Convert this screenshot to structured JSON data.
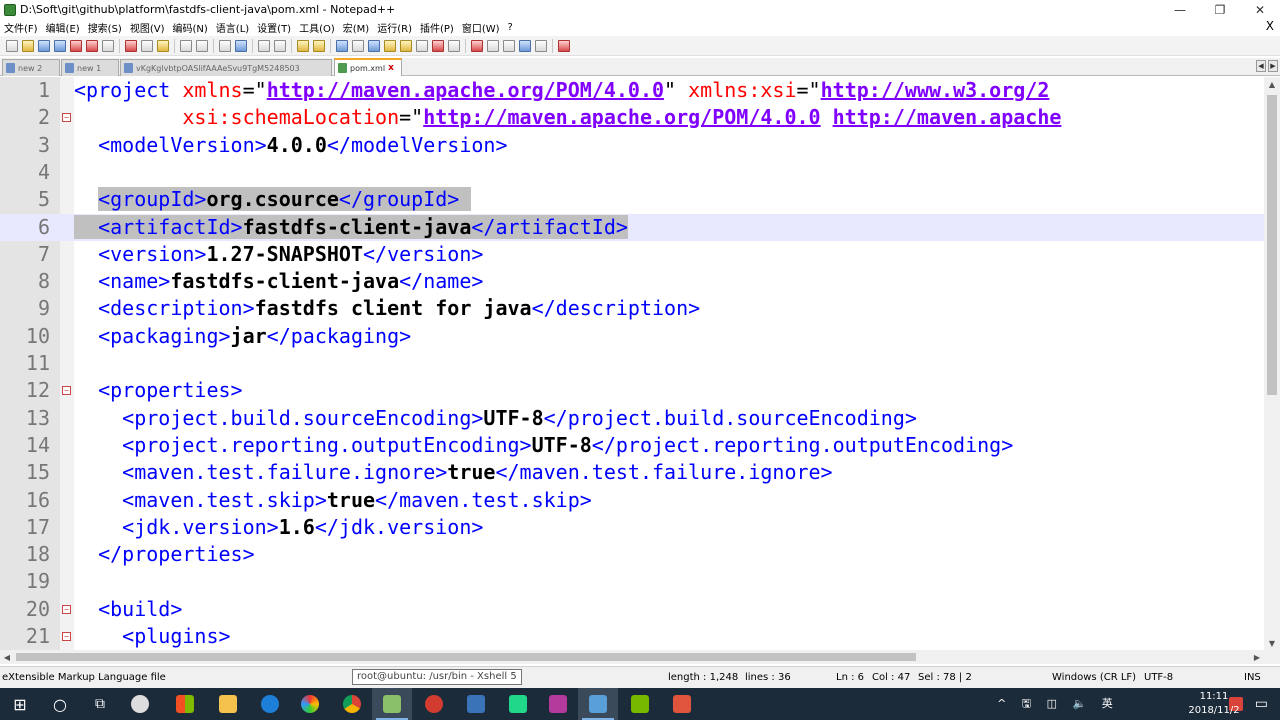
{
  "window": {
    "title": "D:\\Soft\\git\\github\\platform\\fastdfs-client-java\\pom.xml - Notepad++",
    "minimize": "—",
    "maximize": "❐",
    "close": "✕"
  },
  "menu": [
    "文件(F)",
    "编辑(E)",
    "搜索(S)",
    "视图(V)",
    "编码(N)",
    "语言(L)",
    "设置(T)",
    "工具(O)",
    "宏(M)",
    "运行(R)",
    "插件(P)",
    "窗口(W)",
    "?"
  ],
  "menu_close": "X",
  "tabs": [
    {
      "label": "new 2",
      "active": false
    },
    {
      "label": "new 1",
      "active": false
    },
    {
      "label": "vKgKglvbtpOASlifAAAeSvu9TgM5248503",
      "active": false
    },
    {
      "label": "pom.xml",
      "active": true
    }
  ],
  "tab_close": "x",
  "editor": {
    "lines": [
      {
        "n": "1",
        "fold": false,
        "parts": [
          {
            "t": "<project ",
            "c": "tag"
          },
          {
            "t": "xmlns",
            "c": "attr"
          },
          {
            "t": "=\"",
            "c": "eq"
          },
          {
            "t": "http://maven.apache.org/POM/4.0.0",
            "c": "val"
          },
          {
            "t": "\" ",
            "c": "eq"
          },
          {
            "t": "xmlns:xsi",
            "c": "attr"
          },
          {
            "t": "=\"",
            "c": "eq"
          },
          {
            "t": "http://www.w3.org/2",
            "c": "val"
          }
        ]
      },
      {
        "n": "2",
        "fold": true,
        "parts": [
          {
            "t": "         ",
            "c": "eq"
          },
          {
            "t": "xsi:schemaLocation",
            "c": "attr"
          },
          {
            "t": "=\"",
            "c": "eq"
          },
          {
            "t": "http://maven.apache.org/POM/4.0.0",
            "c": "val"
          },
          {
            "t": " ",
            "c": "eq"
          },
          {
            "t": "http://maven.apache",
            "c": "val"
          }
        ]
      },
      {
        "n": "3",
        "fold": false,
        "parts": [
          {
            "t": "  ",
            "c": "eq"
          },
          {
            "t": "<modelVersion>",
            "c": "tag"
          },
          {
            "t": "4.0.0",
            "c": "txt"
          },
          {
            "t": "</modelVersion>",
            "c": "tag"
          }
        ]
      },
      {
        "n": "4",
        "fold": false,
        "parts": []
      },
      {
        "n": "5",
        "fold": false,
        "parts": [
          {
            "t": "  ",
            "c": "eq"
          },
          {
            "t": "<groupId>",
            "c": "tag sel"
          },
          {
            "t": "org.csource",
            "c": "txt sel"
          },
          {
            "t": "</groupId>",
            "c": "tag sel"
          },
          {
            "t": " ",
            "c": "eq sel"
          }
        ]
      },
      {
        "n": "6",
        "fold": false,
        "current": true,
        "parts": [
          {
            "t": "  ",
            "c": "eq sel"
          },
          {
            "t": "<artifactId>",
            "c": "tag sel"
          },
          {
            "t": "fastdfs-client-java",
            "c": "txt sel"
          },
          {
            "t": "</artifactId>",
            "c": "tag sel"
          }
        ]
      },
      {
        "n": "7",
        "fold": false,
        "parts": [
          {
            "t": "  ",
            "c": "eq"
          },
          {
            "t": "<version>",
            "c": "tag"
          },
          {
            "t": "1.27-SNAPSHOT",
            "c": "txt"
          },
          {
            "t": "</version>",
            "c": "tag"
          }
        ]
      },
      {
        "n": "8",
        "fold": false,
        "parts": [
          {
            "t": "  ",
            "c": "eq"
          },
          {
            "t": "<name>",
            "c": "tag"
          },
          {
            "t": "fastdfs-client-java",
            "c": "txt"
          },
          {
            "t": "</name>",
            "c": "tag"
          }
        ]
      },
      {
        "n": "9",
        "fold": false,
        "parts": [
          {
            "t": "  ",
            "c": "eq"
          },
          {
            "t": "<description>",
            "c": "tag"
          },
          {
            "t": "fastdfs client for java",
            "c": "txt"
          },
          {
            "t": "</description>",
            "c": "tag"
          }
        ]
      },
      {
        "n": "10",
        "fold": false,
        "parts": [
          {
            "t": "  ",
            "c": "eq"
          },
          {
            "t": "<packaging>",
            "c": "tag"
          },
          {
            "t": "jar",
            "c": "txt"
          },
          {
            "t": "</packaging>",
            "c": "tag"
          }
        ]
      },
      {
        "n": "11",
        "fold": false,
        "parts": []
      },
      {
        "n": "12",
        "fold": true,
        "parts": [
          {
            "t": "  ",
            "c": "eq"
          },
          {
            "t": "<properties>",
            "c": "tag"
          }
        ]
      },
      {
        "n": "13",
        "fold": false,
        "parts": [
          {
            "t": "    ",
            "c": "eq"
          },
          {
            "t": "<project.build.sourceEncoding>",
            "c": "tag"
          },
          {
            "t": "UTF-8",
            "c": "txt"
          },
          {
            "t": "</project.build.sourceEncoding>",
            "c": "tag"
          }
        ]
      },
      {
        "n": "14",
        "fold": false,
        "parts": [
          {
            "t": "    ",
            "c": "eq"
          },
          {
            "t": "<project.reporting.outputEncoding>",
            "c": "tag"
          },
          {
            "t": "UTF-8",
            "c": "txt"
          },
          {
            "t": "</project.reporting.outputEncoding>",
            "c": "tag"
          }
        ]
      },
      {
        "n": "15",
        "fold": false,
        "parts": [
          {
            "t": "    ",
            "c": "eq"
          },
          {
            "t": "<maven.test.failure.ignore>",
            "c": "tag"
          },
          {
            "t": "true",
            "c": "txt"
          },
          {
            "t": "</maven.test.failure.ignore>",
            "c": "tag"
          }
        ]
      },
      {
        "n": "16",
        "fold": false,
        "parts": [
          {
            "t": "    ",
            "c": "eq"
          },
          {
            "t": "<maven.test.skip>",
            "c": "tag"
          },
          {
            "t": "true",
            "c": "txt"
          },
          {
            "t": "</maven.test.skip>",
            "c": "tag"
          }
        ]
      },
      {
        "n": "17",
        "fold": false,
        "parts": [
          {
            "t": "    ",
            "c": "eq"
          },
          {
            "t": "<jdk.version>",
            "c": "tag"
          },
          {
            "t": "1.6",
            "c": "txt"
          },
          {
            "t": "</jdk.version>",
            "c": "tag"
          }
        ]
      },
      {
        "n": "18",
        "fold": false,
        "parts": [
          {
            "t": "  ",
            "c": "eq"
          },
          {
            "t": "</properties>",
            "c": "tag"
          }
        ]
      },
      {
        "n": "19",
        "fold": false,
        "parts": []
      },
      {
        "n": "20",
        "fold": true,
        "parts": [
          {
            "t": "  ",
            "c": "eq"
          },
          {
            "t": "<build>",
            "c": "tag"
          }
        ]
      },
      {
        "n": "21",
        "fold": true,
        "parts": [
          {
            "t": "    ",
            "c": "eq"
          },
          {
            "t": "<plugins>",
            "c": "tag"
          }
        ]
      }
    ]
  },
  "status": {
    "filetype": "eXtensible Markup Language file",
    "length": "length : 1,248",
    "lines": "lines : 36",
    "ln": "Ln : 6",
    "col": "Col : 47",
    "sel": "Sel : 78 | 2",
    "eol": "Windows (CR LF)",
    "encoding": "UTF-8",
    "mode": "INS"
  },
  "taskbar_tooltip": "root@ubuntu: /usr/bin - Xshell 5",
  "taskbar": {
    "icons": [
      "windows-start-icon",
      "search-icon",
      "task-view-icon",
      "pinwheel-icon",
      "store-icon",
      "file-explorer-icon",
      "edge-icon",
      "paint-icon",
      "chrome-icon",
      "notepadpp-icon",
      "xshell-icon",
      "git-icon",
      "pycharm-icon",
      "intellij-icon",
      "window-icon",
      "terminal-icon",
      "unknown-icon"
    ],
    "tray": "^ 🖫 ◫ 🔈 英",
    "time": "11:11",
    "date": "2018/11/2"
  },
  "colors": {
    "tag": "#0000ff",
    "attr": "#ff0000",
    "value": "#8000ff",
    "selection": "#c0c0c0",
    "current_line": "#e8e8ff",
    "taskbar": "#1c2b3a"
  }
}
